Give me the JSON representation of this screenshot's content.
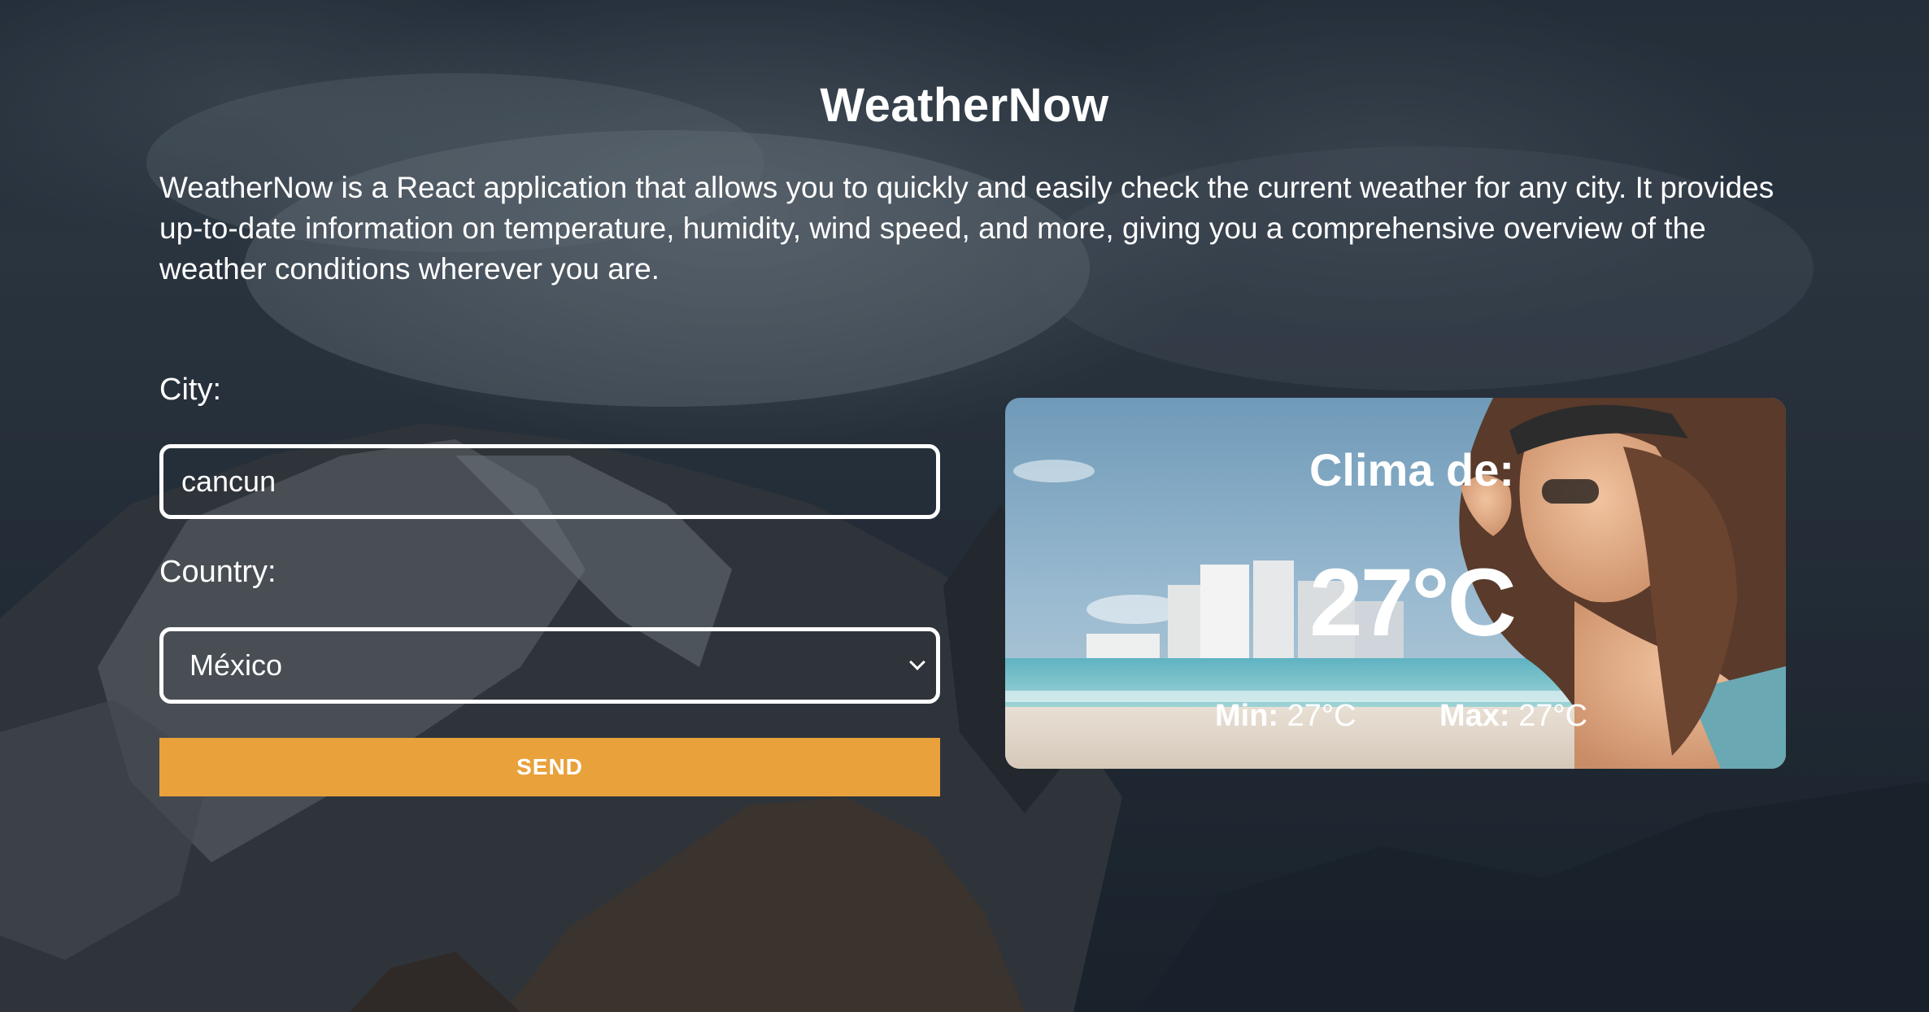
{
  "app": {
    "title": "WeatherNow",
    "description": "WeatherNow is a React application that allows you to quickly and easily check the current weather for any city. It provides up-to-date information on temperature, humidity, wind speed, and more, giving you a comprehensive overview of the weather conditions wherever you are."
  },
  "form": {
    "city_label": "City:",
    "city_value": "cancun",
    "country_label": "Country:",
    "country_selected": "México",
    "send_label": "SEND"
  },
  "weather": {
    "heading": "Clima de:",
    "temperature": "27°C",
    "min_label": "Min:",
    "min_value": "27°C",
    "max_label": "Max:",
    "max_value": "27°C"
  },
  "colors": {
    "accent": "#e9a13b",
    "text": "#ffffff"
  },
  "icons": {
    "select_arrow": "chevron-down-icon"
  }
}
